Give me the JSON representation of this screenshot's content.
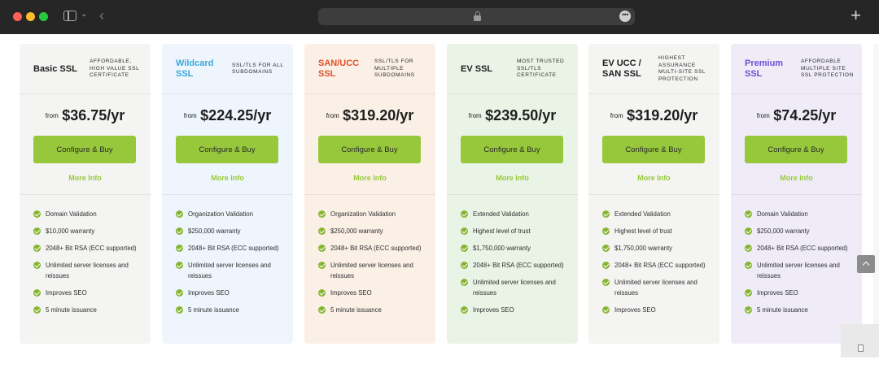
{
  "browser": {
    "icons": {
      "sidebar": "sidebar-icon",
      "back": "back-arrow-icon",
      "lock": "lock-icon",
      "more": "more-options-icon",
      "new_tab": "plus-icon"
    },
    "glyphs": {
      "back": "‹",
      "chevron": "⌄",
      "more": "•••",
      "new_tab": "+"
    }
  },
  "colors": {
    "accent_green": "#97c83b",
    "wildcard_name": "#3aa8e0",
    "san_ucc_name": "#e3502a",
    "premium_name": "#6a4ed6"
  },
  "plans": [
    {
      "name": "Basic SSL",
      "tagline": "AFFORDABLE, HIGH VALUE SSL CERTIFICATE",
      "from_label": "from",
      "price": "$36.75/yr",
      "button_label": "Configure & Buy",
      "more_info_label": "More Info",
      "bg_color": "#f4f4f3",
      "name_color": "#1e1e1e",
      "features": [
        "Domain Validation",
        "$10,000 warranty",
        "2048+ Bit RSA (ECC supported)",
        "Unlimited server licenses and reissues",
        "Improves SEO",
        "5 minute issuance"
      ]
    },
    {
      "name": "Wildcard SSL",
      "tagline": "SSL/TLS FOR ALL SUBDOMAINS",
      "from_label": "from",
      "price": "$224.25/yr",
      "button_label": "Configure & Buy",
      "more_info_label": "More Info",
      "bg_color": "#eef5fc",
      "name_color": "#3aa8e0",
      "features": [
        "Organization Validation",
        "$250,000 warranty",
        "2048+ Bit RSA (ECC supported)",
        "Unlimited server licenses and reissues",
        "Improves SEO",
        "5 minute issuance"
      ]
    },
    {
      "name": "SAN/UCC SSL",
      "tagline": "SSL/TLS FOR MULTIPLE SUBDOMAINS",
      "from_label": "from",
      "price": "$319.20/yr",
      "button_label": "Configure & Buy",
      "more_info_label": "More Info",
      "bg_color": "#fbf0e6",
      "name_color": "#e3502a",
      "features": [
        "Organization Validation",
        "$250,000 warranty",
        "2048+ Bit RSA (ECC supported)",
        "Unlimited server licenses and reissues",
        "Improves SEO",
        "5 minute issuance"
      ]
    },
    {
      "name": "EV SSL",
      "tagline": "MOST TRUSTED SSL/TLS CERTIFICATE",
      "from_label": "from",
      "price": "$239.50/yr",
      "button_label": "Configure & Buy",
      "more_info_label": "More Info",
      "bg_color": "#e9f4e6",
      "name_color": "#1e1e1e",
      "features": [
        "Extended Validation",
        "Highest level of trust",
        "$1,750,000 warranty",
        "2048+ Bit RSA (ECC supported)",
        "Unlimited server licenses and reissues",
        "Improves SEO"
      ]
    },
    {
      "name": "EV UCC / SAN SSL",
      "tagline": "HIGHEST ASSURANCE MULTI-SITE SSL PROTECTION",
      "from_label": "from",
      "price": "$319.20/yr",
      "button_label": "Configure & Buy",
      "more_info_label": "More Info",
      "bg_color": "#f4f4f3",
      "name_color": "#1e1e1e",
      "features": [
        "Extended Validation",
        "Highest level of trust",
        "$1,750,000 warranty",
        "2048+ Bit RSA (ECC supported)",
        "Unlimited server licenses and reissues",
        "Improves SEO"
      ]
    },
    {
      "name": "Premium SSL",
      "tagline": "AFFORDABLE MULTIPLE SITE SSL PROTECTION",
      "from_label": "from",
      "price": "$74.25/yr",
      "button_label": "Configure & Buy",
      "more_info_label": "More Info",
      "bg_color": "#efecf8",
      "name_color": "#6a4ed6",
      "features": [
        "Domain Validation",
        "$250,000 warranty",
        "2048+ Bit RSA (ECC supported)",
        "Unlimited server licenses and reissues",
        "Improves SEO",
        "5 minute issuance"
      ]
    }
  ],
  "page_widgets": {
    "scroll_top_icon": "chevron-up-icon",
    "document_icon": "document-icon"
  }
}
